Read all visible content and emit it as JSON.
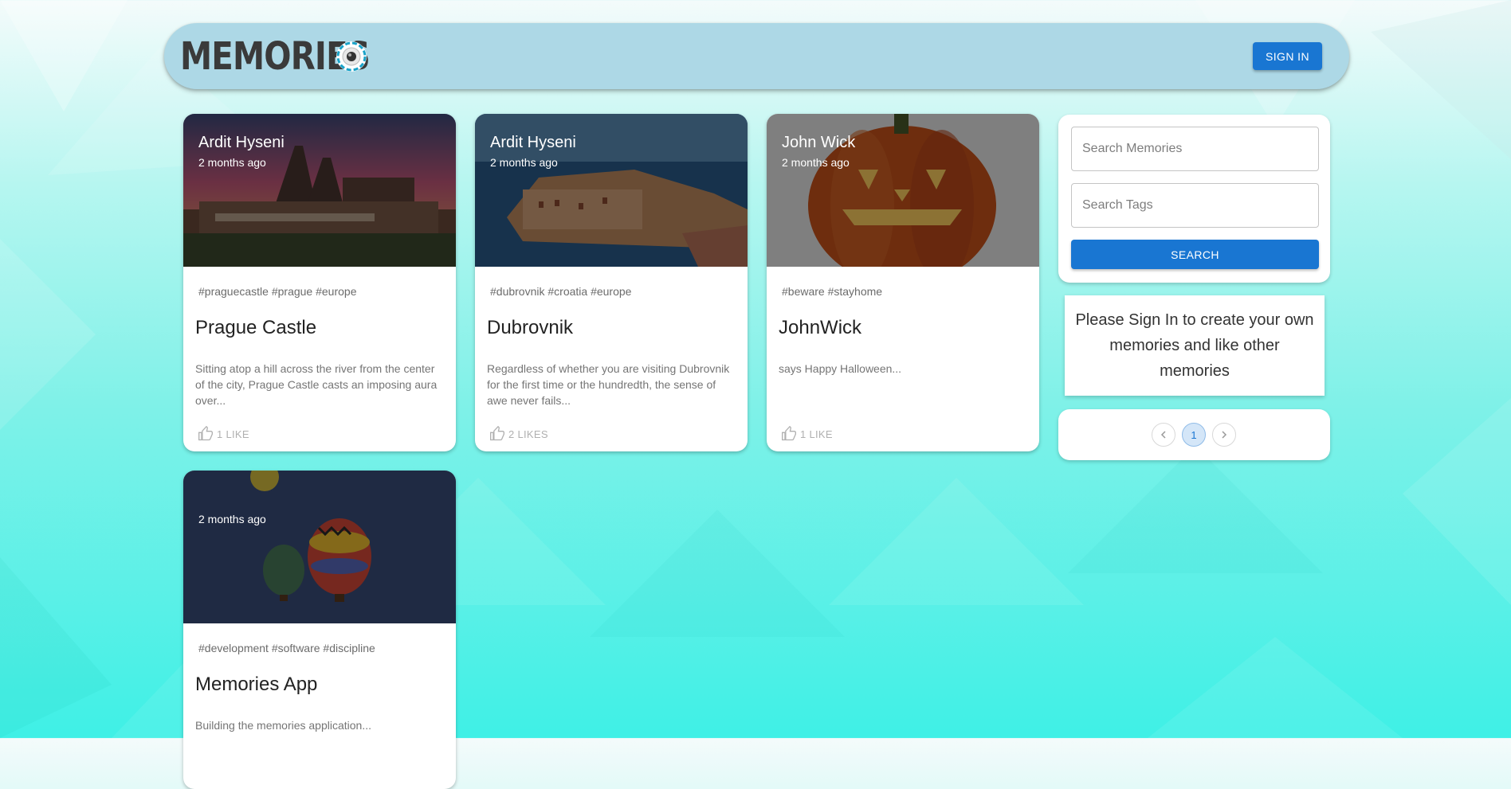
{
  "header": {
    "brand": "Memories",
    "logo_icon": "camera-lens-icon",
    "signin_label": "SIGN IN"
  },
  "posts": [
    {
      "author": "Ardit Hyseni",
      "time": "2 months ago",
      "tags": "#praguecastle #prague #europe",
      "title": "Prague Castle",
      "description": "Sitting atop a hill across the river from the center of the city, Prague Castle casts an imposing aura over...",
      "likes": "1 LIKE",
      "image": "prague-castle-photo"
    },
    {
      "author": "Ardit Hyseni",
      "time": "2 months ago",
      "tags": "#dubrovnik #croatia #europe",
      "title": "Dubrovnik",
      "description": "Regardless of whether you are visiting Dubrovnik for the first time or the hundredth, the sense of awe never fails...",
      "likes": "2 LIKES",
      "image": "dubrovnik-photo"
    },
    {
      "author": "John Wick",
      "time": "2 months ago",
      "tags": "#beware #stayhome",
      "title": "JohnWick",
      "description": "says Happy Halloween...",
      "likes": "1 LIKE",
      "image": "pumpkin-photo"
    },
    {
      "author": "",
      "time": "2 months ago",
      "tags": "#development #software #discipline",
      "title": "Memories App",
      "description": "Building the memories application...",
      "likes": "",
      "image": "hot-air-balloons-photo"
    }
  ],
  "search": {
    "memories_placeholder": "Search Memories",
    "tags_placeholder": "Search Tags",
    "button_label": "SEARCH"
  },
  "notice": "Please Sign In to create your own memories and like other memories",
  "pagination": {
    "current_page": "1",
    "prev_icon": "chevron-left-icon",
    "next_icon": "chevron-right-icon"
  },
  "colors": {
    "appbar": "#add8e6",
    "primary": "#1976d2"
  }
}
